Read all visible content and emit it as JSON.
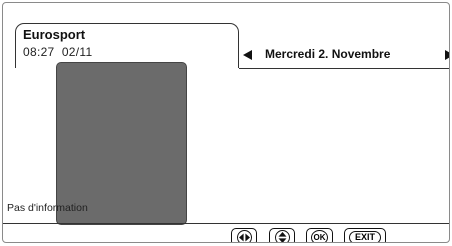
{
  "header": {
    "channel": "Eurosport",
    "time": "08:27",
    "date_short": "02/11",
    "day_label": "Mercredi 2. Novembre"
  },
  "info": {
    "text": "Pas d'information"
  },
  "footer": {
    "keys": [
      {
        "icon": "left-right-arrows-icon"
      },
      {
        "icon": "up-down-arrows-icon"
      },
      {
        "label": "OK"
      },
      {
        "label": "EXIT"
      }
    ]
  },
  "colors": {
    "preview_panel": "#6b6b6b",
    "border": "#333333"
  }
}
